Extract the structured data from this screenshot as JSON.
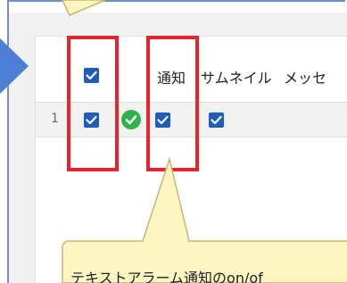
{
  "table": {
    "headers": {
      "notification": "通知",
      "thumbnail": "サムネイル",
      "message": "メッセ"
    },
    "rows": [
      {
        "number": "1",
        "select_checked": true,
        "status": "ok",
        "notification_checked": true,
        "thumbnail_checked": true
      }
    ]
  },
  "callout": {
    "text": "テキストアラーム通知のon/of"
  },
  "colors": {
    "checkbox": "#1e5db8",
    "ok_icon": "#2db34a",
    "highlight": "#e4262c",
    "callout_fill": "#fdf6c3",
    "callout_border": "#c9b56a",
    "arrow": "#4f7fd4"
  }
}
